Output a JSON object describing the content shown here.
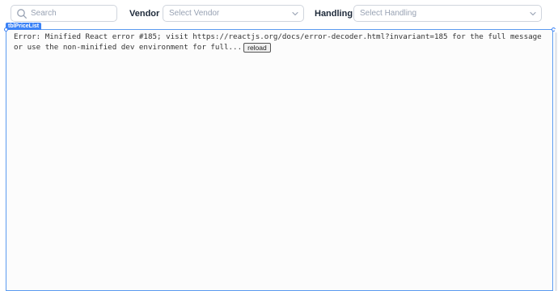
{
  "filters": {
    "search": {
      "placeholder": "Search",
      "value": ""
    },
    "vendor": {
      "label": "Vendor",
      "placeholder": "Select Vendor"
    },
    "handling": {
      "label": "Handling",
      "placeholder": "Select Handling"
    }
  },
  "component": {
    "tag": "tblPriceList",
    "error_message": "Error: Minified React error #185; visit https://reactjs.org/docs/error-decoder.html?invariant=185 for the full message or use the non-minified dev environment for full...",
    "reload_label": "reload"
  },
  "colors": {
    "accent": "#3b82f6",
    "frame_border": "#5b9bf0",
    "border": "#d0d5dd",
    "placeholder": "#98a2b3",
    "label": "#1d2939"
  },
  "icons": {
    "search": "search-icon",
    "dropdown": "chevron-down-icon"
  }
}
